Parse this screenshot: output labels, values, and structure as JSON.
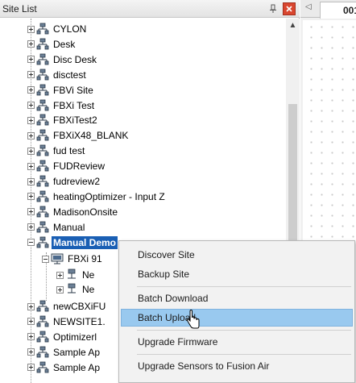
{
  "panel": {
    "title": "Site List",
    "pin_icon": "pin-icon",
    "close_icon": "close-icon"
  },
  "tree": {
    "sites": [
      {
        "label": "CYLON"
      },
      {
        "label": "Desk"
      },
      {
        "label": "Disc Desk"
      },
      {
        "label": "disctest"
      },
      {
        "label": "FBVi Site"
      },
      {
        "label": "FBXi Test"
      },
      {
        "label": "FBXiTest2"
      },
      {
        "label": "FBXiX48_BLANK"
      },
      {
        "label": "fud test"
      },
      {
        "label": "FUDReview"
      },
      {
        "label": "fudreview2"
      },
      {
        "label": "heatingOptimizer - Input Z"
      },
      {
        "label": "MadisonOnsite"
      },
      {
        "label": "Manual"
      },
      {
        "label": "Manual Demo",
        "selected": true
      }
    ],
    "children": [
      {
        "label": "FBXi 91"
      },
      {
        "label": "Ne"
      },
      {
        "label": "Ne"
      }
    ],
    "sites_after": [
      {
        "label": "newCBXiFU"
      },
      {
        "label": "NEWSITE1."
      },
      {
        "label": "Optimizerl"
      },
      {
        "label": "Sample Ap"
      },
      {
        "label": "Sample Ap"
      }
    ]
  },
  "document": {
    "tab_label": "001"
  },
  "context_menu": {
    "items": [
      {
        "label": "Discover Site"
      },
      {
        "label": "Backup Site"
      },
      {
        "label": "Batch Download"
      },
      {
        "label": "Batch Upload",
        "highlighted": true
      },
      {
        "label": "Upgrade Firmware"
      },
      {
        "label": "Upgrade Sensors to Fusion Air"
      }
    ]
  },
  "colors": {
    "selection": "#1a5fb4",
    "menu_highlight": "#99c9ef",
    "close_button": "#d9462f"
  }
}
